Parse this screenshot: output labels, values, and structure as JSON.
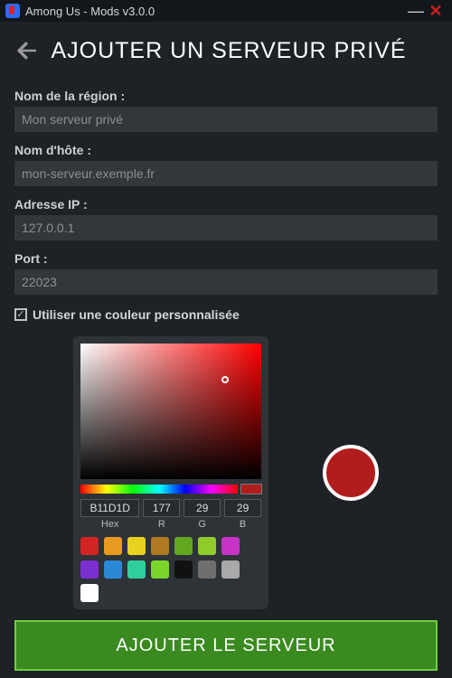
{
  "window": {
    "title": "Among Us - Mods v3.0.0"
  },
  "page": {
    "title": "AJOUTER UN SERVEUR PRIVÉ"
  },
  "form": {
    "region_label": "Nom de la région :",
    "region_value": "Mon serveur privé",
    "host_label": "Nom d'hôte :",
    "host_value": "mon-serveur.exemple.fr",
    "ip_label": "Adresse IP :",
    "ip_value": "127.0.0.1",
    "port_label": "Port :",
    "port_value": "22023",
    "use_color_label": "Utiliser une couleur personnalisée",
    "use_color_checked": true
  },
  "color_picker": {
    "hex": "B11D1D",
    "r": "177",
    "g": "29",
    "b": "29",
    "labels": {
      "hex": "Hex",
      "r": "R",
      "g": "G",
      "b": "B"
    },
    "preview": "#b11d1d",
    "swatches": [
      "#d32323",
      "#e69a1f",
      "#e6d21f",
      "#b07a22",
      "#62a81f",
      "#8fcc2a",
      "#c733c7",
      "#7a2fcf",
      "#2a88d4",
      "#2fcf9d",
      "#7bd42a",
      "#111111",
      "#6f6f6f",
      "#a9a9a9",
      "#ffffff"
    ]
  },
  "submit": {
    "label": "AJOUTER LE SERVEUR"
  }
}
